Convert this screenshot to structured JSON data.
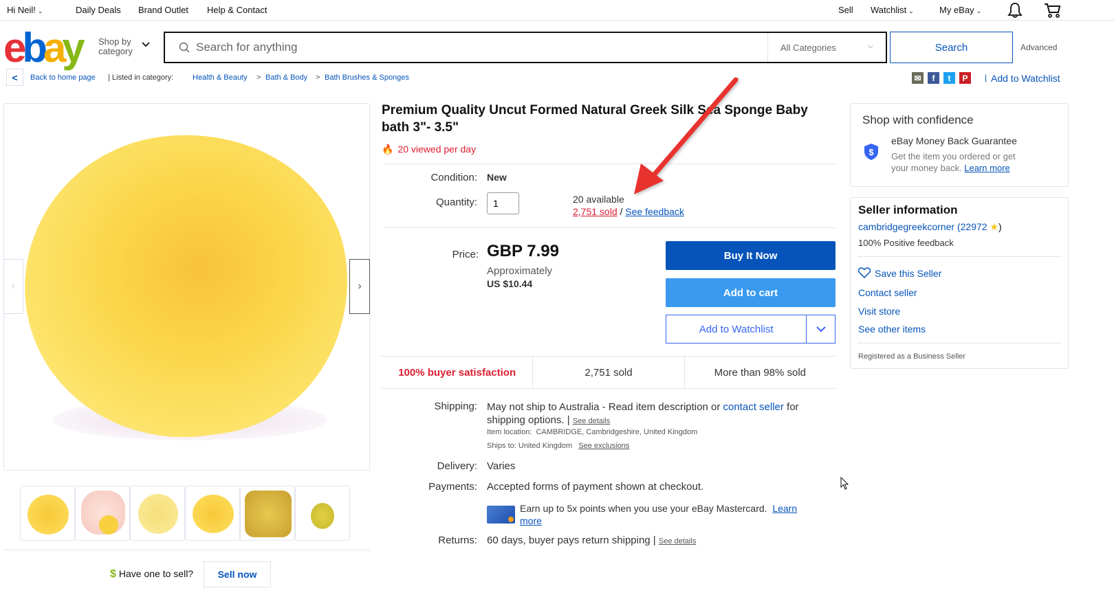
{
  "topbar": {
    "greeting": "Hi Neil!",
    "links": [
      "Daily Deals",
      "Brand Outlet",
      "Help & Contact"
    ],
    "right": {
      "sell": "Sell",
      "watchlist": "Watchlist",
      "my_ebay": "My eBay"
    },
    "icons": [
      "bell-icon",
      "cart-icon"
    ]
  },
  "header": {
    "logo": {
      "e": "e",
      "b": "b",
      "a": "a",
      "y": "y"
    },
    "shop_by_line1": "Shop by",
    "shop_by_line2": "category",
    "search_placeholder": "Search for anything",
    "category_select": "All Categories",
    "search_button": "Search",
    "advanced": "Advanced"
  },
  "breadcrumb": {
    "back": "Back to home page",
    "listed_in": "| Listed in category:",
    "items": [
      "Health & Beauty",
      "Bath & Body",
      "Bath Brushes & Sponges"
    ],
    "separator": ">",
    "add_to_watchlist": "Add to Watchlist"
  },
  "share": {
    "email": "✉",
    "facebook": "f",
    "twitter": "t",
    "pinterest": "P"
  },
  "gallery": {
    "prev": "‹",
    "next": "›",
    "thumbnail_count": 6
  },
  "sell_prompt": {
    "dollar": "$",
    "text": "Have one to sell?",
    "button": "Sell now"
  },
  "item": {
    "title": "Premium Quality Uncut Formed Natural Greek Silk Sea Sponge Baby bath 3\"- 3.5\"",
    "viewed": "20 viewed per day",
    "condition_label": "Condition:",
    "condition": "New",
    "quantity_label": "Quantity:",
    "quantity": "1",
    "available": "20 available",
    "sold_link": "2,751 sold",
    "slash": "/",
    "feedback_link": "See feedback",
    "price_label": "Price:",
    "price": "GBP 7.99",
    "approx": "Approximately",
    "approx_price": "US $10.44",
    "buy_now": "Buy It Now",
    "add_to_cart": "Add to cart",
    "add_to_watchlist": "Add to Watchlist"
  },
  "stats": [
    "100% buyer satisfaction",
    "2,751 sold",
    "More than 98% sold"
  ],
  "shipping": {
    "label": "Shipping:",
    "text1": "May not ship to Australia - Read item description or ",
    "contact_link": "contact seller",
    "text2": " for",
    "text3": "shipping options. |",
    "see_details": "See details",
    "location_label": "Item location:",
    "location": "CAMBRIDGE, Cambridgeshire, United Kingdom",
    "ships_to_label": "Ships to:",
    "ships_to": "United Kingdom",
    "see_exclusions": "See exclusions"
  },
  "delivery": {
    "label": "Delivery:",
    "value": "Varies"
  },
  "payments": {
    "label": "Payments:",
    "value": "Accepted forms of payment shown at checkout.",
    "promo": "Earn up to 5x points when you use your eBay Mastercard.",
    "learn": "Learn",
    "more": "more"
  },
  "returns": {
    "label": "Returns:",
    "value": "60 days, buyer pays return shipping |",
    "see_details": "See details"
  },
  "confidence": {
    "title": "Shop with confidence",
    "guarantee": "eBay Money Back Guarantee",
    "desc1": "Get the item you ordered or get",
    "desc2": "your money back.",
    "learn_more": "Learn more"
  },
  "seller": {
    "title": "Seller information",
    "name": "cambridgegreekcorner",
    "score_open": "(22972",
    "score_close": ")",
    "positive": "100% Positive feedback",
    "save": "Save this Seller",
    "contact": "Contact seller",
    "visit": "Visit store",
    "other": "See other items",
    "registered": "Registered as a Business Seller"
  },
  "colors": {
    "accent": "#0654ba",
    "red": "#dd1e31",
    "annotation_arrow": "#e8322e"
  }
}
